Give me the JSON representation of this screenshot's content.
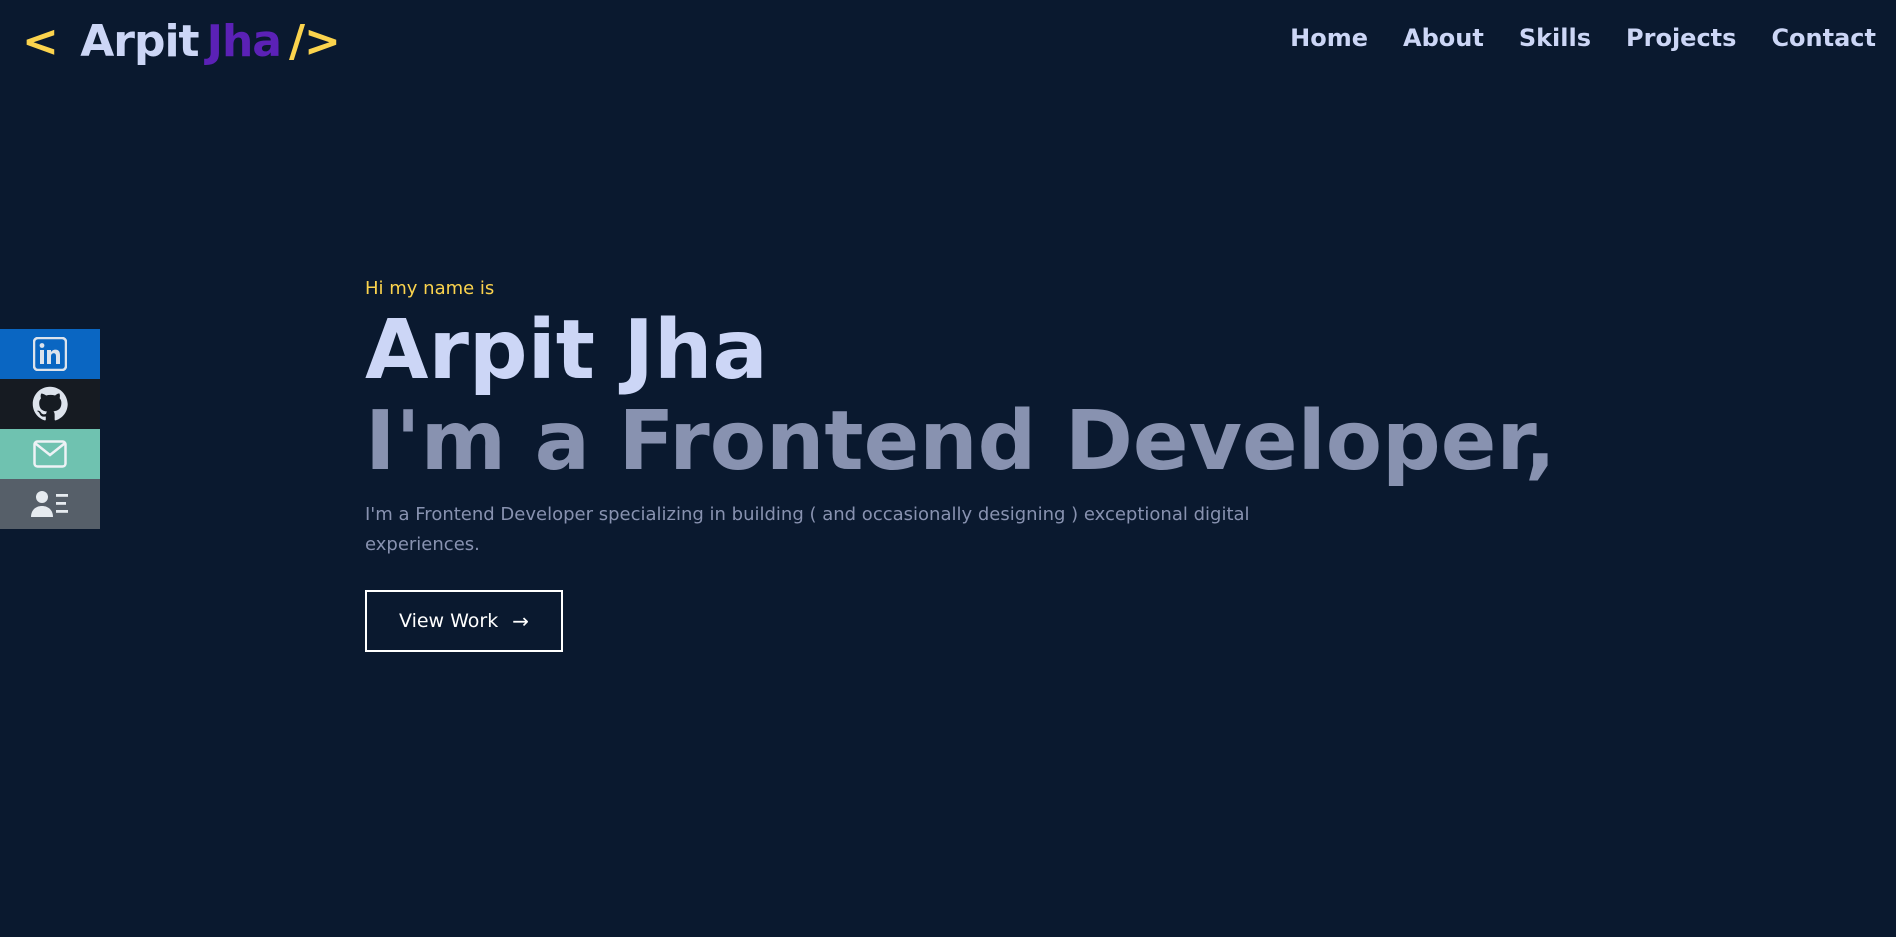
{
  "logo": {
    "open_bracket": "<",
    "first_name": "Arpit",
    "last_name": "Jha",
    "close_bracket": "/>"
  },
  "nav": {
    "items": [
      "Home",
      "About",
      "Skills",
      "Projects",
      "Contact"
    ]
  },
  "social": [
    {
      "name": "linkedin-icon",
      "color": "#0a66c2"
    },
    {
      "name": "github-icon",
      "color": "#161b22"
    },
    {
      "name": "mail-icon",
      "color": "#6fc2b0"
    },
    {
      "name": "resume-icon",
      "color": "#565f69"
    }
  ],
  "hero": {
    "greeting": "Hi my name is",
    "name": "Arpit Jha",
    "role": "I'm a Frontend Developer,",
    "description": "I'm a Frontend Developer specializing in building ( and occasionally designing ) exceptional digital experiences.",
    "button_label": "View Work",
    "button_icon": "arrow-right-icon"
  },
  "colors": {
    "background": "#0a192f",
    "accent_yellow": "#fbd34d",
    "accent_purple": "#5b21b6",
    "heading": "#ccd6f6",
    "muted": "#8892b0"
  }
}
